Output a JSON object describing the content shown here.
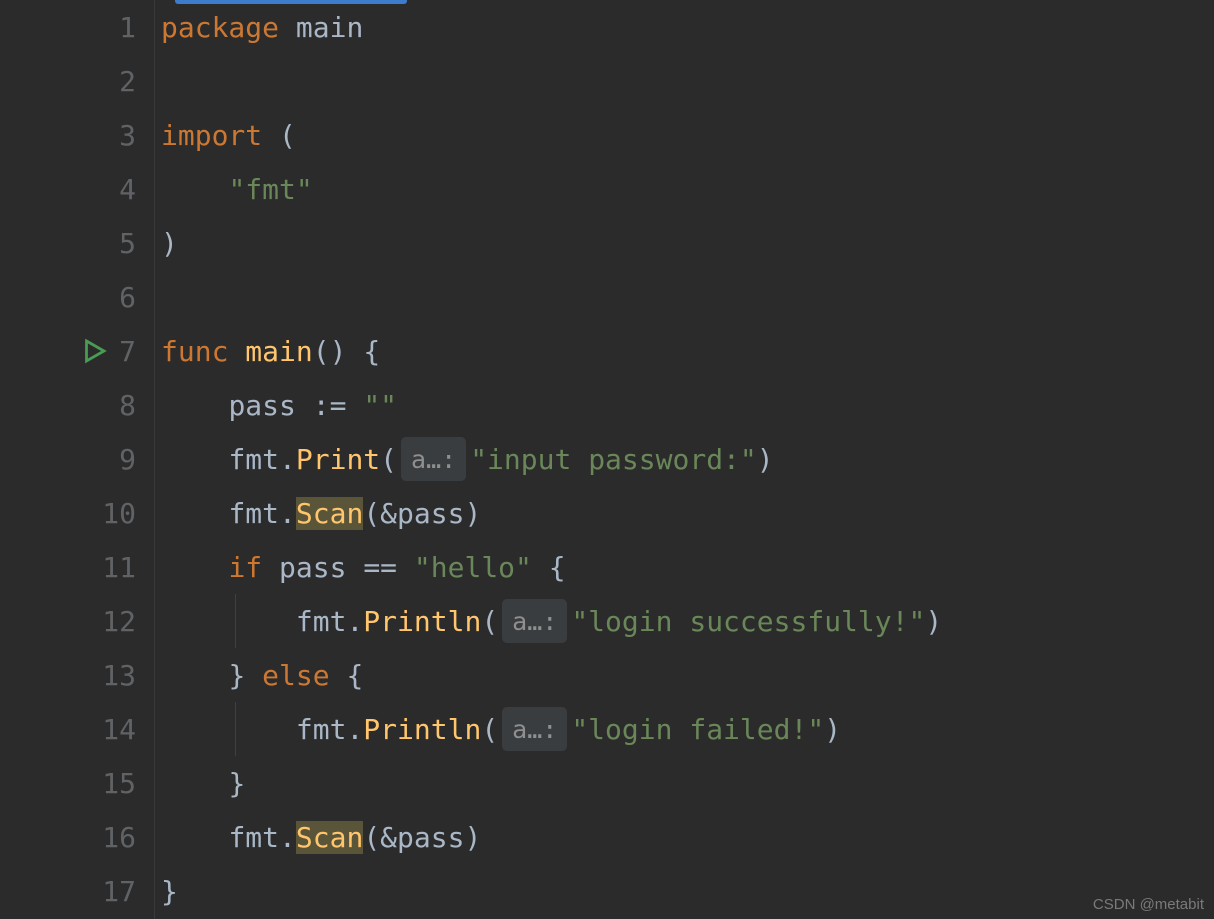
{
  "gutter": {
    "lines": [
      "1",
      "2",
      "3",
      "4",
      "5",
      "6",
      "7",
      "8",
      "9",
      "10",
      "11",
      "12",
      "13",
      "14",
      "15",
      "16",
      "17"
    ],
    "run_line": 7
  },
  "tokens": {
    "package": "package",
    "main": "main",
    "import": "import",
    "lparen": "(",
    "rparen": ")",
    "fmt_str": "\"fmt\"",
    "func": "func",
    "lbrace": "{",
    "rbrace": "}",
    "pass": "pass",
    "decl": ":=",
    "empty_str": "\"\"",
    "fmt": "fmt",
    "dot": ".",
    "Print": "Print",
    "Scan": "Scan",
    "Println": "Println",
    "amp_pass": "&pass",
    "if": "if",
    "eq": "==",
    "hello_str": "\"hello\"",
    "else": "else",
    "input_password": "\"input password:\"",
    "login_success": "\"login successfully!\"",
    "login_failed": "\"login failed!\""
  },
  "hints": {
    "a": "a…:"
  },
  "watermark": "CSDN @metabit"
}
